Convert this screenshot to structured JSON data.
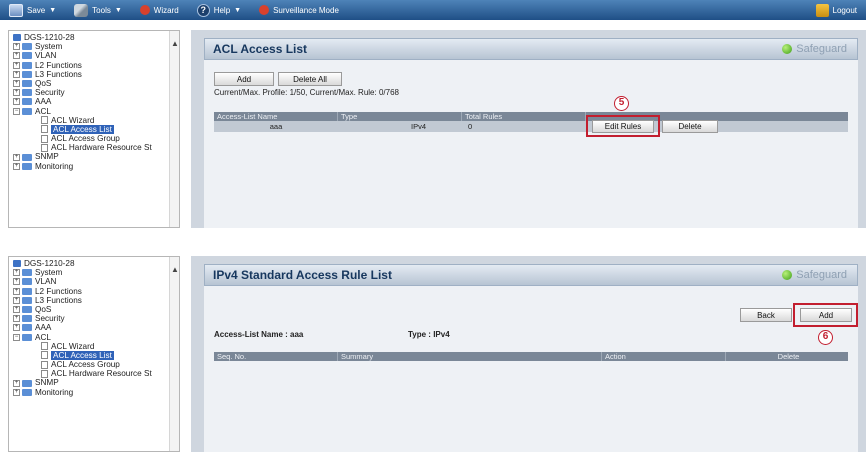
{
  "toolbar": {
    "save": "Save",
    "tools": "Tools",
    "wizard": "Wizard",
    "help": "Help",
    "surveillance": "Surveillance Mode",
    "logout": "Logout"
  },
  "tree": {
    "root": "DGS-1210-28",
    "items": [
      {
        "label": "System"
      },
      {
        "label": "VLAN"
      },
      {
        "label": "L2 Functions"
      },
      {
        "label": "L3 Functions"
      },
      {
        "label": "QoS"
      },
      {
        "label": "Security"
      },
      {
        "label": "AAA"
      },
      {
        "label": "ACL"
      }
    ],
    "acl_children": [
      "ACL Wizard",
      "ACL Access List",
      "ACL Access Group",
      "ACL Hardware Resource St"
    ],
    "after": [
      "SNMP",
      "Monitoring"
    ]
  },
  "panel1": {
    "title": "ACL Access List",
    "safeguard": "Safeguard",
    "add_button": "Add",
    "delete_all_button": "Delete All",
    "info": "Current/Max. Profile: 1/50, Current/Max. Rule: 0/768",
    "columns": [
      "Access-List Name",
      "Type",
      "Total Rules",
      ""
    ],
    "row": {
      "name": "aaa",
      "type": "IPv4",
      "total": "0"
    },
    "edit_rules_button": "Edit Rules",
    "delete_button": "Delete",
    "badge": "5"
  },
  "panel2": {
    "title": "IPv4 Standard Access Rule List",
    "safeguard": "Safeguard",
    "back_button": "Back",
    "add_button": "Add",
    "list_name_label": "Access-List Name : aaa",
    "type_label": "Type : IPv4",
    "columns": [
      "Seq. No.",
      "Summary",
      "Action",
      "Delete"
    ],
    "badge": "6"
  }
}
